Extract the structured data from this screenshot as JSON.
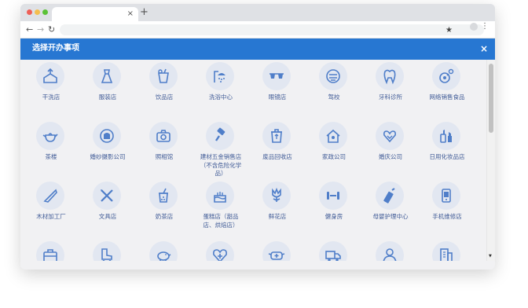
{
  "browser": {
    "new_tab_symbol": "+",
    "tab_close_symbol": "×"
  },
  "modal": {
    "title": "选择开办事项",
    "close_symbol": "×"
  },
  "colors": {
    "header": "#2777d2",
    "icon": "#4f7ec9",
    "icon_bg": "#e2e7f1",
    "label": "#3f5a96"
  },
  "items": [
    {
      "label": "干洗店",
      "icon": "laundry-icon"
    },
    {
      "label": "服装店",
      "icon": "dress-icon"
    },
    {
      "label": "饮品店",
      "icon": "drink-cup-icon"
    },
    {
      "label": "洗浴中心",
      "icon": "shower-icon"
    },
    {
      "label": "眼镜店",
      "icon": "glasses-icon"
    },
    {
      "label": "驾校",
      "icon": "driving-school-icon"
    },
    {
      "label": "牙科诊所",
      "icon": "tooth-icon"
    },
    {
      "label": "网络销售食品",
      "icon": "online-food-icon"
    },
    {
      "label": "茶楼",
      "icon": "teapot-icon"
    },
    {
      "label": "婚纱摄影公司",
      "icon": "wedding-photo-icon"
    },
    {
      "label": "照相馆",
      "icon": "camera-icon"
    },
    {
      "label": "建材五金销售店（不含危险化学品）",
      "icon": "paint-roller-icon"
    },
    {
      "label": "废品回收店",
      "icon": "recycle-bin-icon"
    },
    {
      "label": "家政公司",
      "icon": "house-icon"
    },
    {
      "label": "婚庆公司",
      "icon": "heart-hands-icon"
    },
    {
      "label": "日用化妆品店",
      "icon": "cosmetics-icon"
    },
    {
      "label": "木材加工厂",
      "icon": "saw-icon"
    },
    {
      "label": "文具店",
      "icon": "stationery-icon"
    },
    {
      "label": "奶茶店",
      "icon": "milk-tea-icon"
    },
    {
      "label": "蛋糕店（甜品店、烘焙店）",
      "icon": "cake-icon"
    },
    {
      "label": "鲜花店",
      "icon": "flower-icon"
    },
    {
      "label": "健身房",
      "icon": "dumbbell-icon"
    },
    {
      "label": "母婴护理中心",
      "icon": "baby-bottle-icon"
    },
    {
      "label": "手机维修店",
      "icon": "phone-repair-icon"
    },
    {
      "label": "",
      "icon": "tool-box-icon"
    },
    {
      "label": "",
      "icon": "roller-skate-icon"
    },
    {
      "label": "",
      "icon": "piggy-bank-icon"
    },
    {
      "label": "",
      "icon": "medical-heart-icon"
    },
    {
      "label": "",
      "icon": "mask-icon"
    },
    {
      "label": "",
      "icon": "truck-icon"
    },
    {
      "label": "",
      "icon": "person-icon"
    },
    {
      "label": "",
      "icon": "building-icon"
    }
  ]
}
